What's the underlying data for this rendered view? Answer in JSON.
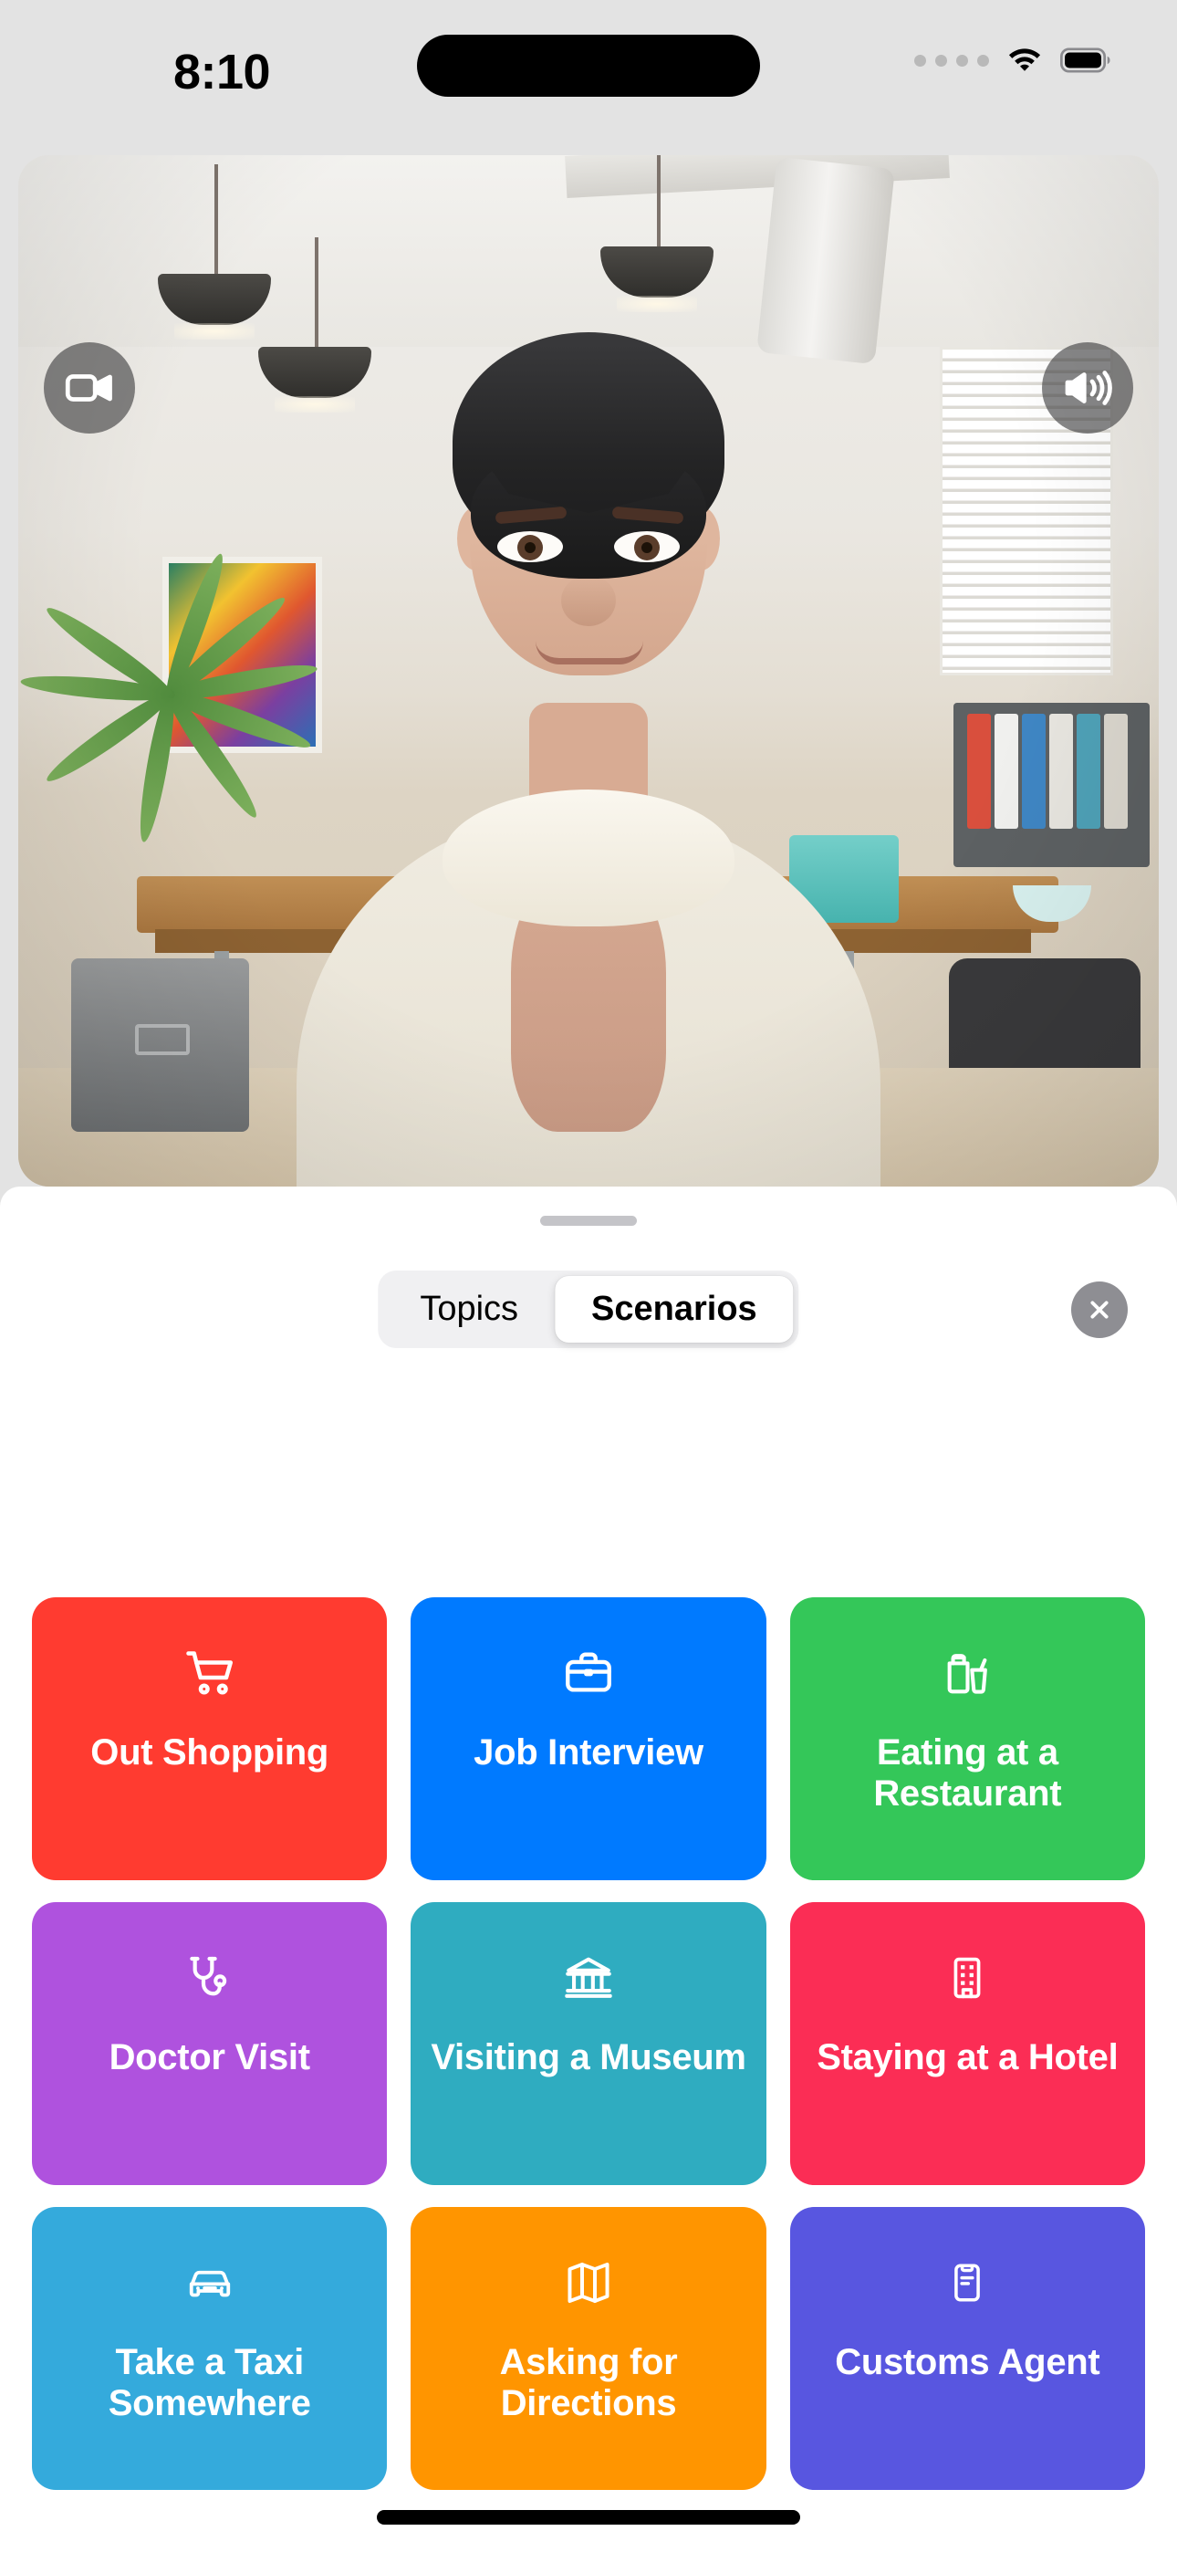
{
  "status_bar": {
    "time": "8:10",
    "icons": [
      "cellular-dots-icon",
      "wifi-icon",
      "battery-icon"
    ]
  },
  "video": {
    "scene_description": "3D avatar woman in an office",
    "controls": [
      {
        "name": "video-toggle-button",
        "icon": "video-camera-icon"
      },
      {
        "name": "speaker-toggle-button",
        "icon": "speaker-wave-icon"
      }
    ]
  },
  "sheet": {
    "grabber": "drag-handle",
    "segments": [
      {
        "label": "Topics",
        "selected": false
      },
      {
        "label": "Scenarios",
        "selected": true
      }
    ],
    "close_label": "✕"
  },
  "scenarios": [
    {
      "label": "Out Shopping",
      "icon": "shopping-cart-icon",
      "color": "#FF3B30"
    },
    {
      "label": "Job Interview",
      "icon": "briefcase-icon",
      "color": "#007AFF"
    },
    {
      "label": "Eating at a Restaurant",
      "icon": "takeout-bag-drink-icon",
      "color": "#34C759"
    },
    {
      "label": "Doctor Visit",
      "icon": "stethoscope-icon",
      "color": "#AF52DE"
    },
    {
      "label": "Visiting a Museum",
      "icon": "museum-building-icon",
      "color": "#2FACC0"
    },
    {
      "label": "Staying at a Hotel",
      "icon": "hotel-building-icon",
      "color": "#FB2D55"
    },
    {
      "label": "Take a Taxi Somewhere",
      "icon": "car-icon",
      "color": "#34AADC"
    },
    {
      "label": "Asking for Directions",
      "icon": "map-icon",
      "color": "#FF9500"
    },
    {
      "label": "Customs Agent",
      "icon": "clipboard-icon",
      "color": "#5856E0"
    }
  ]
}
